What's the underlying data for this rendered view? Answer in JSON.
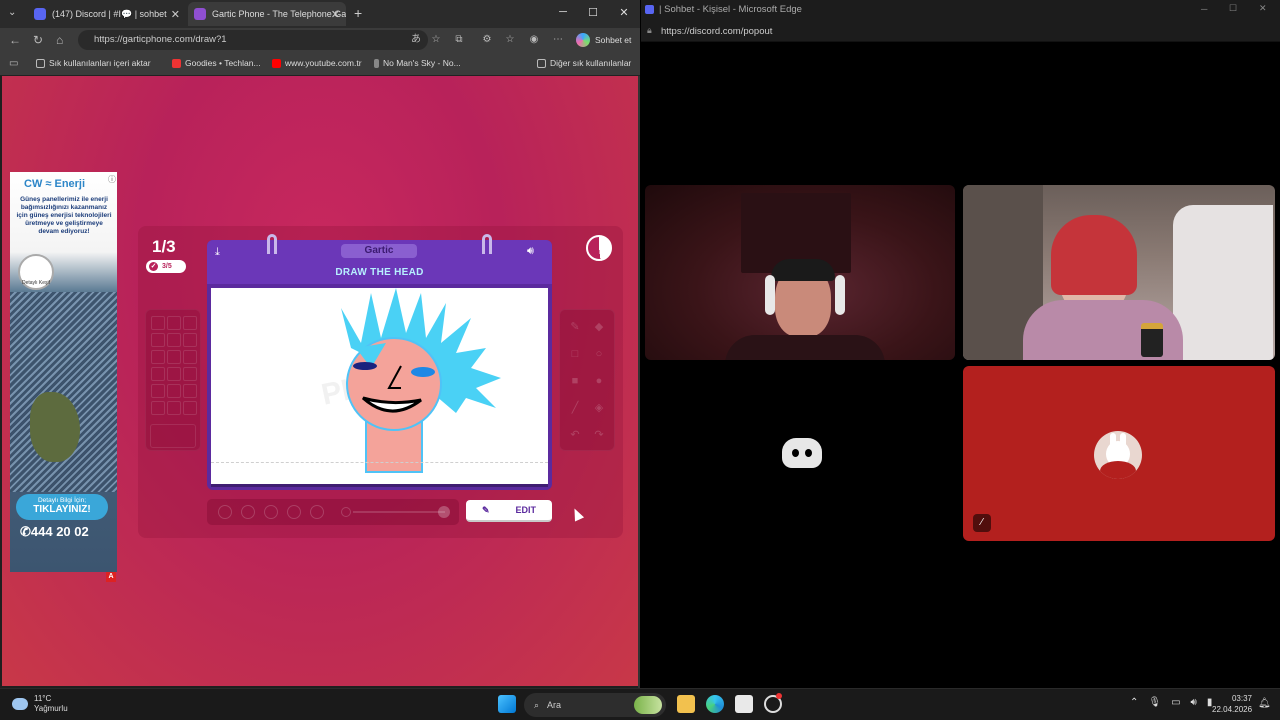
{
  "left_browser": {
    "tabs": [
      {
        "label": "(147) Discord | #Ⅰ💬 | sohbet",
        "color": "#5865f2"
      },
      {
        "label": "Gartic Phone - The Telephone Gam",
        "color": "#8f4fd1"
      }
    ],
    "new_tab": "+",
    "window_controls": {
      "minimize": "─",
      "maximize": "☐",
      "close": "✕"
    },
    "url": "https://garticphone.com/draw?1",
    "sohbet_label": "Sohbet et",
    "bookmarks": [
      {
        "label": "Sık kullanılanları içeri aktar"
      },
      {
        "label": "Goodies • Techlan..."
      },
      {
        "label": "www.youtube.com.tr"
      },
      {
        "label": "No Man's Sky - No..."
      }
    ],
    "other_bookmarks": "Diğer sık kullanılanlar"
  },
  "ad": {
    "brand": "CW ≈ Enerji",
    "text": "Güneş panellerimiz ile enerji bağımsızlığınızı kazanmanız için güneş enerjisi teknolojileri üretmeye ve geliştirmeye devam ediyoruz!",
    "badge": "Detaylı Keşif",
    "cta_small": "Detaylı Bilgi İçin;",
    "cta_big": "TIKLAYINIZ!",
    "phone": "✆444 20 02",
    "flag": "A"
  },
  "game": {
    "round": "1/3",
    "progress": "3/5",
    "logo": "Gartic",
    "instruction": "DRAW THE HEAD",
    "edit_label": "EDIT",
    "canvas_watermark": "PHONE"
  },
  "right_window": {
    "title": "| Sohbet - Kişisel - Microsoft Edge",
    "url": "https://discord.com/popout"
  },
  "taskbar": {
    "weather_temp": "11°C",
    "weather_desc": "Yağmurlu",
    "search_placeholder": "Ara",
    "time": "03:37",
    "date": "22.04.2026"
  }
}
